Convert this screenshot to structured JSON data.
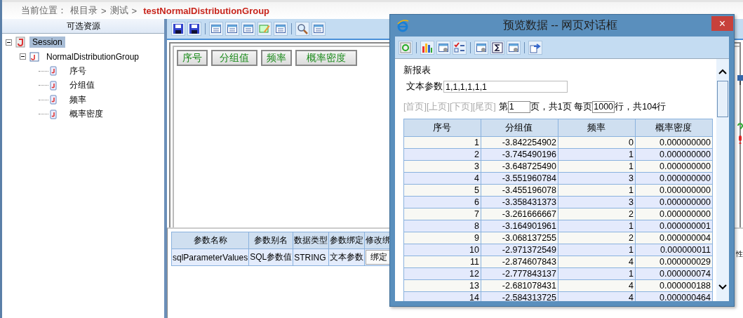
{
  "breadcrumb": {
    "label": "当前位置：",
    "path": [
      "根目录",
      "测试"
    ],
    "separator": ">",
    "current": "testNormalDistributionGroup"
  },
  "resources": {
    "title": "可选资源",
    "tree": [
      {
        "label": "Session",
        "selected": true,
        "expanded": true,
        "children": [
          {
            "label": "NormalDistributionGroup",
            "selected": false,
            "expanded": true,
            "children": [
              {
                "label": "序号",
                "selected": false
              },
              {
                "label": "分组值",
                "selected": false
              },
              {
                "label": "频率",
                "selected": false
              },
              {
                "label": "概率密度",
                "selected": false
              }
            ]
          }
        ]
      }
    ]
  },
  "designer": {
    "fields": [
      "序号",
      "分组值",
      "频率",
      "概率密度"
    ]
  },
  "params": {
    "columns": [
      "参数名称",
      "参数别名",
      "数据类型",
      "参数绑定",
      "修改绑"
    ],
    "rows": [
      {
        "cells": [
          "sqlParameterValues",
          "SQL参数值",
          "STRING",
          "文本参数"
        ],
        "button": "绑定"
      }
    ]
  },
  "side_text": "性",
  "dialog": {
    "title": "预览数据 -- 网页对话框",
    "close": "×",
    "report_title": "新报表",
    "param_label": "文本参数",
    "param_value": "1,1,1,1,1,1",
    "pager": {
      "links": [
        {
          "label": "[首页]",
          "disabled": true
        },
        {
          "label": "[上页]",
          "disabled": true
        },
        {
          "label": "[下页]",
          "disabled": true
        },
        {
          "label": "[尾页]",
          "disabled": true
        }
      ],
      "page_prefix": "第",
      "page_value": "1",
      "page_suffix": "页，共1页 每页",
      "size_value": "1000",
      "size_suffix": "行，共104行"
    },
    "table": {
      "columns": [
        "序号",
        "分组值",
        "频率",
        "概率密度"
      ],
      "rows": [
        [
          "1",
          "-3.842254902",
          "0",
          "0.000000000"
        ],
        [
          "2",
          "-3.745490196",
          "1",
          "0.000000000"
        ],
        [
          "3",
          "-3.648725490",
          "1",
          "0.000000000"
        ],
        [
          "4",
          "-3.551960784",
          "3",
          "0.000000000"
        ],
        [
          "5",
          "-3.455196078",
          "1",
          "0.000000000"
        ],
        [
          "6",
          "-3.358431373",
          "3",
          "0.000000000"
        ],
        [
          "7",
          "-3.261666667",
          "2",
          "0.000000000"
        ],
        [
          "8",
          "-3.164901961",
          "1",
          "0.000000001"
        ],
        [
          "9",
          "-3.068137255",
          "2",
          "0.000000004"
        ],
        [
          "10",
          "-2.971372549",
          "1",
          "0.000000011"
        ],
        [
          "11",
          "-2.874607843",
          "4",
          "0.000000029"
        ],
        [
          "12",
          "-2.777843137",
          "1",
          "0.000000074"
        ],
        [
          "13",
          "-2.681078431",
          "4",
          "0.000000188"
        ],
        [
          "14",
          "-2.584313725",
          "4",
          "0.000000464"
        ]
      ]
    }
  }
}
